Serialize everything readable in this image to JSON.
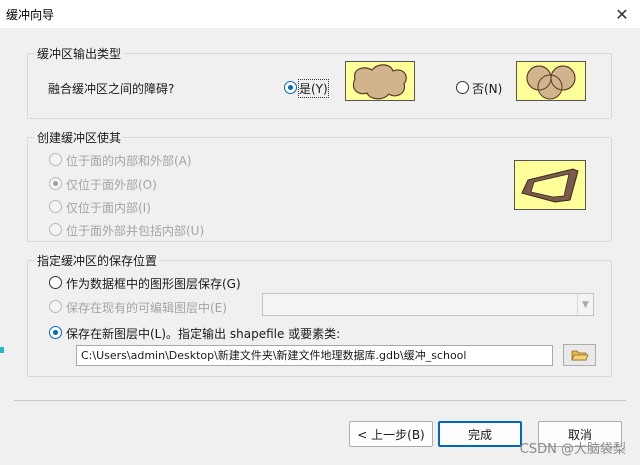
{
  "window": {
    "title": "缓冲向导",
    "close_glyph": "✕"
  },
  "output_type": {
    "legend": "缓冲区输出类型",
    "question": "融合缓冲区之间的障碍?",
    "yes_label": "是(Y)",
    "no_label": "否(N)",
    "selected": "yes"
  },
  "side_type": {
    "legend": "创建缓冲区使其",
    "options": [
      "位于面的内部和外部(A)",
      "仅位于面外部(O)",
      "仅位于面内部(I)",
      "位于面外部并包括内部(U)"
    ],
    "selected_index": 1,
    "enabled": false
  },
  "save_location": {
    "legend": "指定缓冲区的保存位置",
    "options": [
      "作为数据框中的图形图层保存(G)",
      "保存在现有的可编辑图层中(E)",
      "保存在新图层中(L)。指定输出 shapefile 或要素类:"
    ],
    "selected_index": 2,
    "existing_layer_value": "",
    "output_path": "C:\\Users\\admin\\Desktop\\新建文件夹\\新建文件地理数据库.gdb\\缓冲_school"
  },
  "footer": {
    "back_label": "< 上一步(B)",
    "finish_label": "完成",
    "cancel_label": "取消"
  },
  "watermark": "CSDN @大脑袋梨",
  "colors": {
    "accent": "#0067c0",
    "preview_bg": "#ffff99",
    "buffer_fill": "#d2b48c"
  },
  "icons": {
    "close": "close-icon",
    "folder": "open-folder-icon",
    "dropdown": "chevron-down-icon"
  }
}
